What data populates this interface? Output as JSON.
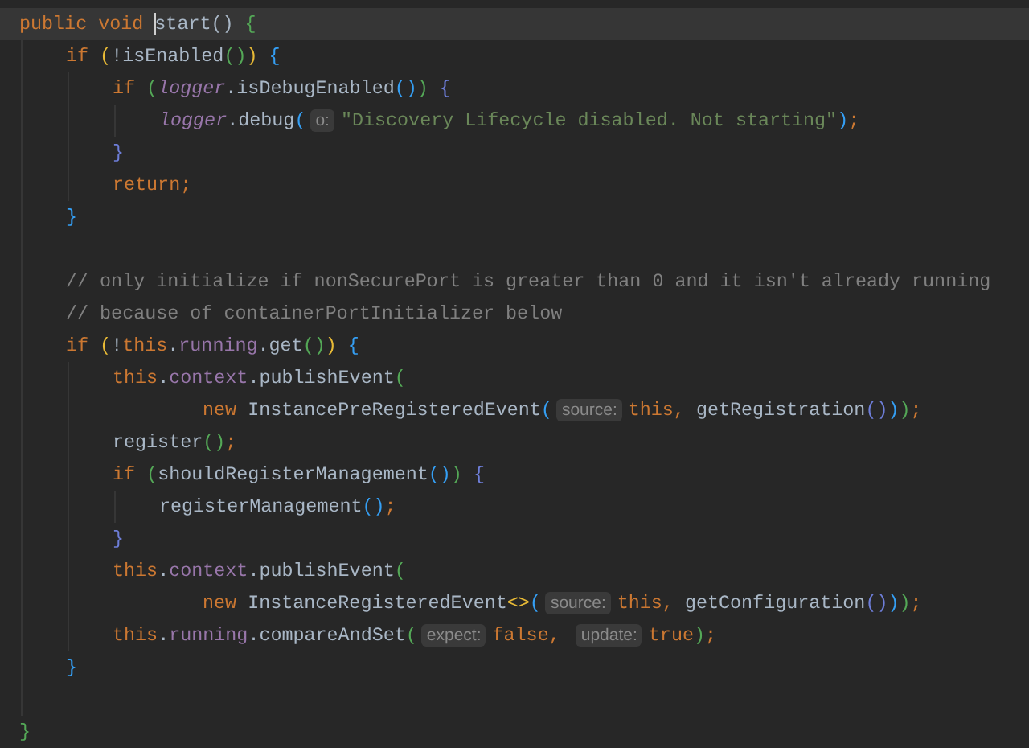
{
  "lines": [
    {
      "current": true,
      "tokens": [
        {
          "kind": "keyword",
          "text": "public void "
        },
        {
          "kind": "plain",
          "text": "start",
          "cursor": true
        },
        {
          "kind": "plain",
          "text": "() "
        },
        {
          "kind": "bracket",
          "text": "{",
          "color": "#54a857"
        }
      ],
      "children": [
        {
          "current": false,
          "tokens": [
            {
              "kind": "keyword",
              "text": "if "
            },
            {
              "kind": "bracket",
              "text": "(",
              "color": "#e8ba36"
            },
            {
              "kind": "plain",
              "text": "!isEnabled"
            },
            {
              "kind": "bracket",
              "text": "()",
              "color": "#54a857"
            },
            {
              "kind": "bracket",
              "text": ")",
              "color": "#e8ba36"
            },
            {
              "kind": "bracket",
              "text": " {",
              "color": "#359ff4"
            }
          ],
          "children": [
            {
              "current": false,
              "tokens": [
                {
                  "kind": "keyword",
                  "text": "if "
                },
                {
                  "kind": "bracket",
                  "text": "(",
                  "color": "#54a857"
                },
                {
                  "kind": "static",
                  "text": "logger"
                },
                {
                  "kind": "plain",
                  "text": ".isDebugEnabled"
                },
                {
                  "kind": "bracket",
                  "text": "()",
                  "color": "#359ff4"
                },
                {
                  "kind": "bracket",
                  "text": ")",
                  "color": "#54a857"
                },
                {
                  "kind": "bracket",
                  "text": " {",
                  "color": "#6e7ed9"
                }
              ],
              "children": [
                {
                  "current": false,
                  "tokens": [
                    {
                      "kind": "static",
                      "text": "logger"
                    },
                    {
                      "kind": "plain",
                      "text": ".debug"
                    },
                    {
                      "kind": "bracket",
                      "text": "(",
                      "color": "#359ff4"
                    },
                    {
                      "kind": "hint",
                      "text": "o:"
                    },
                    {
                      "kind": "string",
                      "text": "\"Discovery Lifecycle disabled. Not starting\""
                    },
                    {
                      "kind": "bracket",
                      "text": ")",
                      "color": "#359ff4"
                    },
                    {
                      "kind": "keyword",
                      "text": ";"
                    }
                  ]
                }
              ]
            },
            {
              "current": false,
              "tokens": [
                {
                  "kind": "bracket",
                  "text": "}",
                  "color": "#6e7ed9"
                }
              ]
            },
            {
              "current": false,
              "tokens": [
                {
                  "kind": "keyword",
                  "text": "return;"
                }
              ]
            }
          ]
        },
        {
          "current": false,
          "tokens": [
            {
              "kind": "bracket",
              "text": "}",
              "color": "#359ff4"
            }
          ]
        },
        {
          "current": false
        },
        {
          "current": false,
          "tokens": [
            {
              "kind": "comment",
              "text": "// only initialize if nonSecurePort is greater than 0 and it isn't already running"
            }
          ]
        },
        {
          "current": false,
          "tokens": [
            {
              "kind": "comment",
              "text": "// because of containerPortInitializer below"
            }
          ]
        },
        {
          "current": false,
          "tokens": [
            {
              "kind": "keyword",
              "text": "if "
            },
            {
              "kind": "bracket",
              "text": "(",
              "color": "#e8ba36"
            },
            {
              "kind": "plain",
              "text": "!"
            },
            {
              "kind": "keyword",
              "text": "this"
            },
            {
              "kind": "plain",
              "text": "."
            },
            {
              "kind": "field",
              "text": "running"
            },
            {
              "kind": "plain",
              "text": ".get"
            },
            {
              "kind": "bracket",
              "text": "()",
              "color": "#54a857"
            },
            {
              "kind": "bracket",
              "text": ")",
              "color": "#e8ba36"
            },
            {
              "kind": "bracket",
              "text": " {",
              "color": "#359ff4"
            }
          ],
          "children": [
            {
              "current": false,
              "tokens": [
                {
                  "kind": "keyword",
                  "text": "this"
                },
                {
                  "kind": "plain",
                  "text": "."
                },
                {
                  "kind": "field",
                  "text": "context"
                },
                {
                  "kind": "plain",
                  "text": ".publishEvent"
                },
                {
                  "kind": "bracket",
                  "text": "(",
                  "color": "#54a857"
                }
              ]
            },
            {
              "current": false,
              "kind": "continuation",
              "tokens": [
                {
                  "kind": "keyword",
                  "text": "new "
                },
                {
                  "kind": "plain",
                  "text": "InstancePreRegisteredEvent"
                },
                {
                  "kind": "bracket",
                  "text": "(",
                  "color": "#359ff4"
                },
                {
                  "kind": "hint",
                  "text": "source:"
                },
                {
                  "kind": "keyword",
                  "text": "this, "
                },
                {
                  "kind": "plain",
                  "text": "getRegistration"
                },
                {
                  "kind": "bracket",
                  "text": "()",
                  "color": "#6e7ed9"
                },
                {
                  "kind": "bracket",
                  "text": ")",
                  "color": "#359ff4"
                },
                {
                  "kind": "bracket",
                  "text": ")",
                  "color": "#54a857"
                },
                {
                  "kind": "keyword",
                  "text": ";"
                }
              ]
            },
            {
              "current": false,
              "tokens": [
                {
                  "kind": "plain",
                  "text": "register"
                },
                {
                  "kind": "bracket",
                  "text": "()",
                  "color": "#54a857"
                },
                {
                  "kind": "keyword",
                  "text": ";"
                }
              ]
            },
            {
              "current": false,
              "tokens": [
                {
                  "kind": "keyword",
                  "text": "if "
                },
                {
                  "kind": "bracket",
                  "text": "(",
                  "color": "#54a857"
                },
                {
                  "kind": "plain",
                  "text": "shouldRegisterManagement"
                },
                {
                  "kind": "bracket",
                  "text": "()",
                  "color": "#359ff4"
                },
                {
                  "kind": "bracket",
                  "text": ")",
                  "color": "#54a857"
                },
                {
                  "kind": "bracket",
                  "text": " {",
                  "color": "#6e7ed9"
                }
              ],
              "children": [
                {
                  "current": false,
                  "tokens": [
                    {
                      "kind": "plain",
                      "text": "registerManagement"
                    },
                    {
                      "kind": "bracket",
                      "text": "()",
                      "color": "#359ff4"
                    },
                    {
                      "kind": "keyword",
                      "text": ";"
                    }
                  ]
                }
              ]
            },
            {
              "current": false,
              "tokens": [
                {
                  "kind": "bracket",
                  "text": "}",
                  "color": "#6e7ed9"
                }
              ]
            },
            {
              "current": false,
              "tokens": [
                {
                  "kind": "keyword",
                  "text": "this"
                },
                {
                  "kind": "plain",
                  "text": "."
                },
                {
                  "kind": "field",
                  "text": "context"
                },
                {
                  "kind": "plain",
                  "text": ".publishEvent"
                },
                {
                  "kind": "bracket",
                  "text": "(",
                  "color": "#54a857"
                }
              ]
            },
            {
              "current": false,
              "kind": "continuation",
              "tokens": [
                {
                  "kind": "keyword",
                  "text": "new "
                },
                {
                  "kind": "plain",
                  "text": "InstanceRegisteredEvent"
                },
                {
                  "kind": "bracket",
                  "text": "<>",
                  "color": "#e8ba36"
                },
                {
                  "kind": "bracket",
                  "text": "(",
                  "color": "#359ff4"
                },
                {
                  "kind": "hint",
                  "text": "source:"
                },
                {
                  "kind": "keyword",
                  "text": "this, "
                },
                {
                  "kind": "plain",
                  "text": "getConfiguration"
                },
                {
                  "kind": "bracket",
                  "text": "()",
                  "color": "#6e7ed9"
                },
                {
                  "kind": "bracket",
                  "text": ")",
                  "color": "#359ff4"
                },
                {
                  "kind": "bracket",
                  "text": ")",
                  "color": "#54a857"
                },
                {
                  "kind": "keyword",
                  "text": ";"
                }
              ]
            },
            {
              "current": false,
              "tokens": [
                {
                  "kind": "keyword",
                  "text": "this"
                },
                {
                  "kind": "plain",
                  "text": "."
                },
                {
                  "kind": "field",
                  "text": "running"
                },
                {
                  "kind": "plain",
                  "text": ".compareAndSet"
                },
                {
                  "kind": "bracket",
                  "text": "(",
                  "color": "#54a857"
                },
                {
                  "kind": "hint",
                  "text": "expect:"
                },
                {
                  "kind": "keyword",
                  "text": "false, "
                },
                {
                  "kind": "hint",
                  "text": "update:"
                },
                {
                  "kind": "keyword",
                  "text": "true"
                },
                {
                  "kind": "bracket",
                  "text": ")",
                  "color": "#54a857"
                },
                {
                  "kind": "keyword",
                  "text": ";"
                }
              ]
            }
          ]
        },
        {
          "current": false,
          "tokens": [
            {
              "kind": "bracket",
              "text": "}",
              "color": "#359ff4"
            }
          ]
        },
        {
          "current": false
        }
      ]
    },
    {
      "current": false,
      "tokens": [
        {
          "kind": "bracket",
          "text": "}",
          "color": "#54a857"
        }
      ]
    }
  ]
}
